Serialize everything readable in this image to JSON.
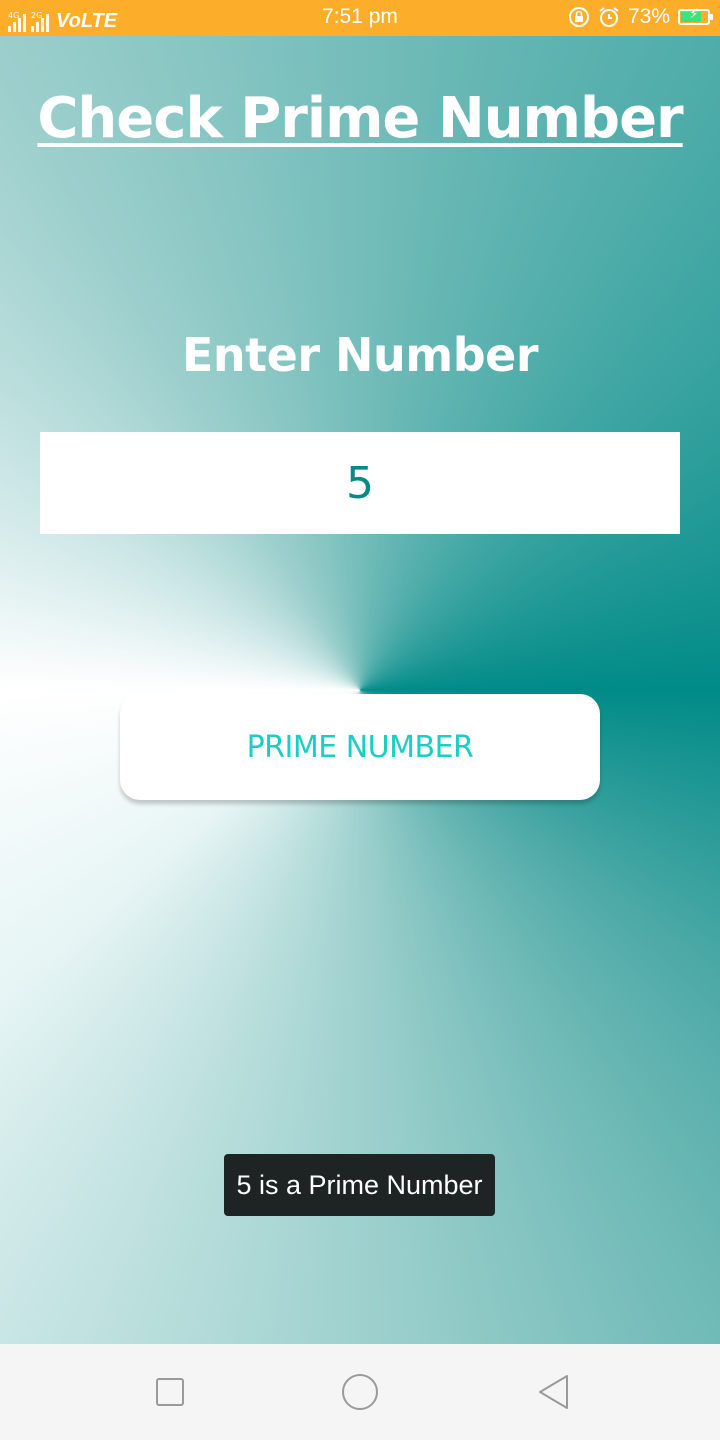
{
  "status_bar": {
    "network_1": "4G",
    "network_2": "2G",
    "volte": "VoLTE",
    "time": "7:51 pm",
    "battery_percent": "73%",
    "battery_level": 0.73,
    "icons": [
      "signal-icon",
      "signal-icon",
      "lock-rotation-icon",
      "alarm-icon",
      "battery-charging-icon"
    ]
  },
  "app": {
    "title": "Check Prime Number",
    "input_label": "Enter Number",
    "input_value": "5",
    "button_label": "PRIME NUMBER",
    "toast_message": "5 is a Prime Number"
  },
  "nav_bar": {
    "icons": [
      "recent-apps-icon",
      "home-icon",
      "back-icon"
    ]
  },
  "colors": {
    "status_bar": "#fcae2a",
    "teal_dark": "#008b88",
    "button_text": "#19cfc4",
    "input_text": "#058a87",
    "toast_bg": "#1e2323"
  }
}
